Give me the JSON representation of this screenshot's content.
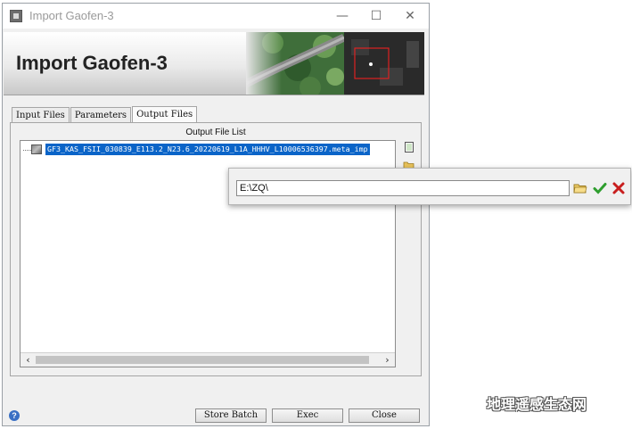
{
  "window": {
    "title": "Import Gaofen-3",
    "banner_title": "Import Gaofen-3"
  },
  "tabs": [
    {
      "label": "Input Files",
      "active": false
    },
    {
      "label": "Parameters",
      "active": false
    },
    {
      "label": "Output Files",
      "active": true
    }
  ],
  "output_panel": {
    "caption": "Output File List",
    "files": [
      {
        "name": "GF3_KAS_FSII_030839_E113.2_N23.6_20220619_L1A_HHHV_L10006536397.meta_imp",
        "selected": true
      }
    ]
  },
  "popup": {
    "path_value": "E:\\ZQ\\"
  },
  "buttons": {
    "store_batch": "Store Batch",
    "exec": "Exec",
    "close": "Close"
  },
  "icons": {
    "window_controls": [
      "minimize-icon",
      "maximize-icon",
      "close-icon"
    ],
    "side": [
      "new-file-icon",
      "open-folder-icon"
    ],
    "popup": [
      "folder-icon",
      "checkmark-icon",
      "cancel-icon"
    ],
    "help": "help-icon"
  },
  "colors": {
    "selection": "#0a64c8",
    "accept_green": "#2e9e2e",
    "cancel_red": "#c81e1e",
    "help_blue": "#3a6fc4"
  },
  "watermark": {
    "text": "地理遥感生态网"
  }
}
